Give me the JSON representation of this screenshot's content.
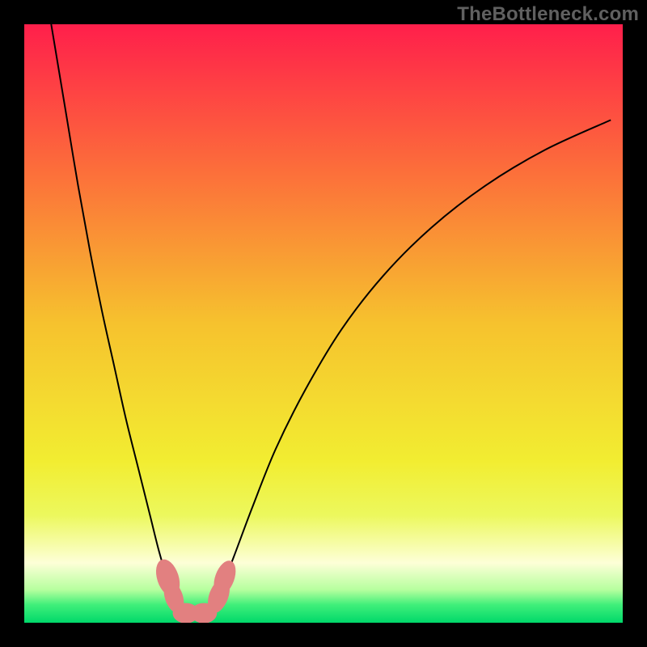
{
  "watermark": "TheBottleneck.com",
  "chart_data": {
    "type": "line",
    "title": "",
    "xlabel": "",
    "ylabel": "",
    "xlim": [
      0,
      100
    ],
    "ylim": [
      0,
      100
    ],
    "grid": false,
    "background_gradient_stops": [
      {
        "offset": 0.0,
        "color": "#ff1f4b"
      },
      {
        "offset": 0.25,
        "color": "#fc703a"
      },
      {
        "offset": 0.5,
        "color": "#f6c22e"
      },
      {
        "offset": 0.73,
        "color": "#f2ed31"
      },
      {
        "offset": 0.82,
        "color": "#ecf85d"
      },
      {
        "offset": 0.9,
        "color": "#fdffd7"
      },
      {
        "offset": 0.945,
        "color": "#b6ff9e"
      },
      {
        "offset": 0.97,
        "color": "#40ef7a"
      },
      {
        "offset": 1.0,
        "color": "#00d86a"
      }
    ],
    "series": [
      {
        "name": "bottleneck-curve",
        "stroke": "#000000",
        "stroke_width": 2,
        "points": [
          {
            "x": 4.5,
            "y": 100.0
          },
          {
            "x": 5.5,
            "y": 94.0
          },
          {
            "x": 7.0,
            "y": 85.0
          },
          {
            "x": 9.0,
            "y": 73.0
          },
          {
            "x": 11.0,
            "y": 62.0
          },
          {
            "x": 13.0,
            "y": 52.0
          },
          {
            "x": 15.0,
            "y": 43.0
          },
          {
            "x": 17.0,
            "y": 34.0
          },
          {
            "x": 19.0,
            "y": 26.0
          },
          {
            "x": 21.0,
            "y": 18.0
          },
          {
            "x": 22.5,
            "y": 12.0
          },
          {
            "x": 24.0,
            "y": 7.0
          },
          {
            "x": 25.5,
            "y": 3.0
          },
          {
            "x": 27.0,
            "y": 1.5
          },
          {
            "x": 29.0,
            "y": 1.5
          },
          {
            "x": 31.0,
            "y": 2.5
          },
          {
            "x": 33.0,
            "y": 6.0
          },
          {
            "x": 35.0,
            "y": 11.0
          },
          {
            "x": 38.0,
            "y": 19.0
          },
          {
            "x": 42.0,
            "y": 29.0
          },
          {
            "x": 47.0,
            "y": 39.0
          },
          {
            "x": 53.0,
            "y": 49.0
          },
          {
            "x": 60.0,
            "y": 58.0
          },
          {
            "x": 68.0,
            "y": 66.0
          },
          {
            "x": 77.0,
            "y": 73.0
          },
          {
            "x": 87.0,
            "y": 79.0
          },
          {
            "x": 98.0,
            "y": 84.0
          }
        ]
      }
    ],
    "markers": [
      {
        "name": "marker-left-a",
        "x": 24.0,
        "y": 7.5,
        "rx": 1.8,
        "ry": 3.2,
        "rotate": -18,
        "color": "#e28080"
      },
      {
        "name": "marker-left-b",
        "x": 25.0,
        "y": 4.3,
        "rx": 1.5,
        "ry": 2.8,
        "rotate": -18,
        "color": "#e28080"
      },
      {
        "name": "marker-bottom-a",
        "x": 27.0,
        "y": 1.6,
        "rx": 2.2,
        "ry": 1.7,
        "rotate": 0,
        "color": "#e28080"
      },
      {
        "name": "marker-bottom-b",
        "x": 30.0,
        "y": 1.6,
        "rx": 2.2,
        "ry": 1.7,
        "rotate": 0,
        "color": "#e28080"
      },
      {
        "name": "marker-right-a",
        "x": 32.5,
        "y": 4.5,
        "rx": 1.6,
        "ry": 3.0,
        "rotate": 20,
        "color": "#e28080"
      },
      {
        "name": "marker-right-b",
        "x": 33.5,
        "y": 7.5,
        "rx": 1.6,
        "ry": 3.0,
        "rotate": 20,
        "color": "#e28080"
      }
    ]
  }
}
